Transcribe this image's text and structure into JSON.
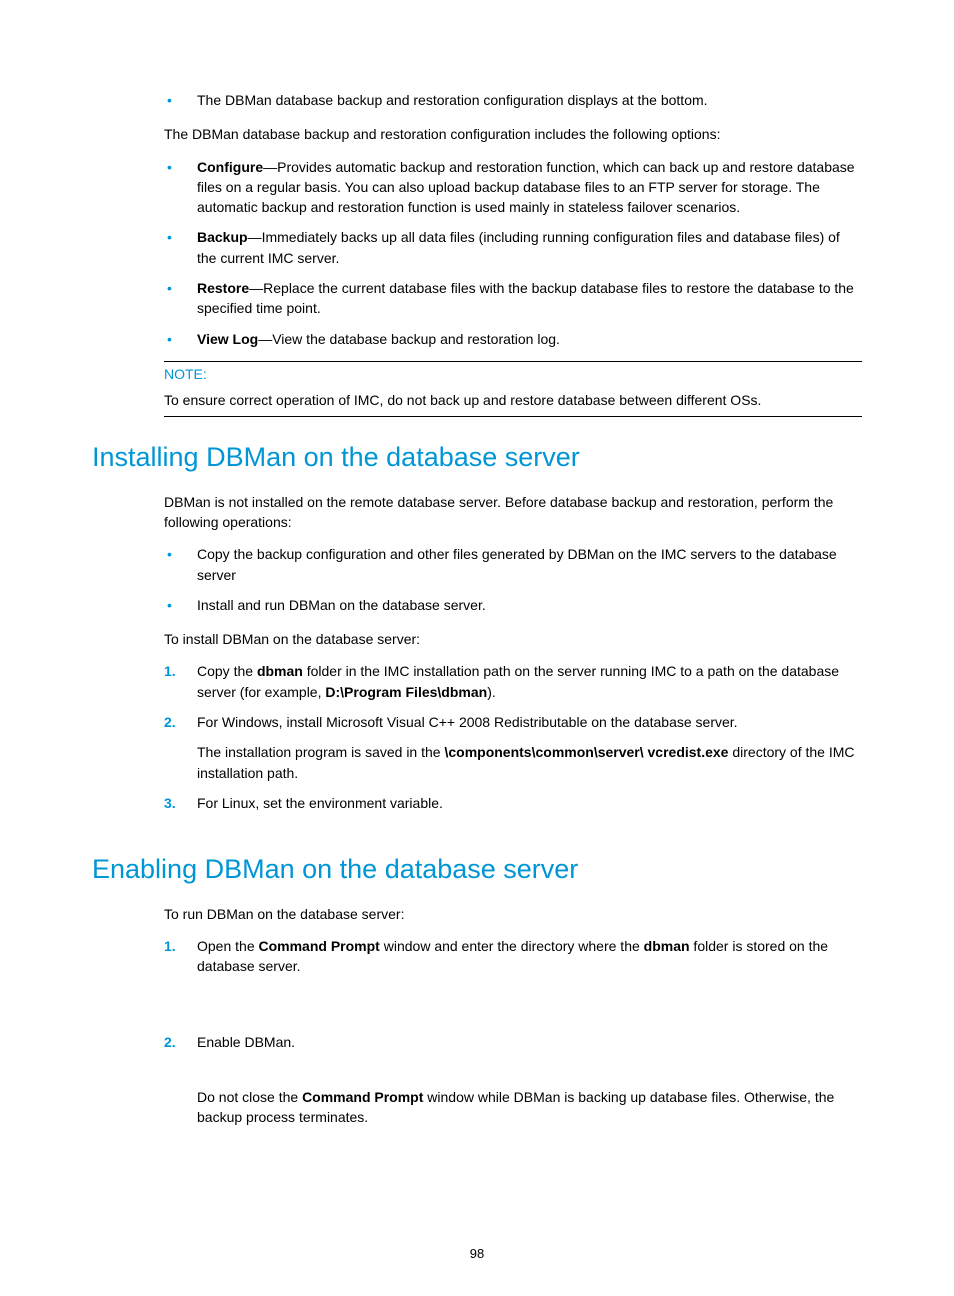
{
  "bullet_top": {
    "item1": "The DBMan database backup and restoration configuration displays at the bottom."
  },
  "intro_para": "The DBMan database backup and restoration configuration includes the following options:",
  "options": {
    "configure_label": "Configure",
    "configure_text": "—Provides automatic backup and restoration function, which can back up and restore database files on a regular basis. You can also upload backup database files to an FTP server for storage. The automatic backup and restoration function is used mainly in stateless failover scenarios.",
    "backup_label": "Backup",
    "backup_text": "—Immediately backs up all data files (including running configuration files and database files) of the current IMC server.",
    "restore_label": "Restore",
    "restore_text": "—Replace the current database files with the backup database files to restore the database to the specified time point.",
    "viewlog_label": "View Log",
    "viewlog_text": "—View the database backup and restoration log."
  },
  "note": {
    "label": "NOTE:",
    "text": "To ensure correct operation of IMC, do not back up and restore database between different OSs."
  },
  "h2_install": "Installing DBMan on the database server",
  "install_intro": "DBMan is not installed on the remote database server. Before database backup and restoration, perform the following operations:",
  "install_bullets": {
    "b1": "Copy the backup configuration and other files generated by DBMan on the IMC servers to the database server",
    "b2": "Install and run DBMan on the database server."
  },
  "install_lead": "To install DBMan on the database server:",
  "install_steps": {
    "n1": "1.",
    "s1a": "Copy the ",
    "s1b": "dbman",
    "s1c": " folder in the IMC installation path on the server running IMC to a path on the database server (for example, ",
    "s1d": "D:\\Program Files\\dbman",
    "s1e": ").",
    "n2": "2.",
    "s2a": "For Windows, install Microsoft Visual C++ 2008 Redistributable on the database server.",
    "s2b_pre": "The installation program is saved in the ",
    "s2b_bold": "\\components\\common\\server\\ vcredist.exe",
    "s2b_post": " directory of the IMC installation path.",
    "n3": "3.",
    "s3": "For Linux, set the environment variable."
  },
  "h2_enable": "Enabling DBMan on the database server",
  "enable_lead": "To run DBMan on the database server:",
  "enable_steps": {
    "n1": "1.",
    "s1a": "Open the ",
    "s1b": "Command Prompt",
    "s1c": " window and enter the directory where the ",
    "s1d": "dbman",
    "s1e": " folder is stored on the database server.",
    "n2": "2.",
    "s2": "Enable DBMan.",
    "s2b_pre": "Do not close the ",
    "s2b_bold": "Command Prompt",
    "s2b_post": " window while DBMan is backing up database files. Otherwise, the backup process terminates."
  },
  "page_number": "98"
}
